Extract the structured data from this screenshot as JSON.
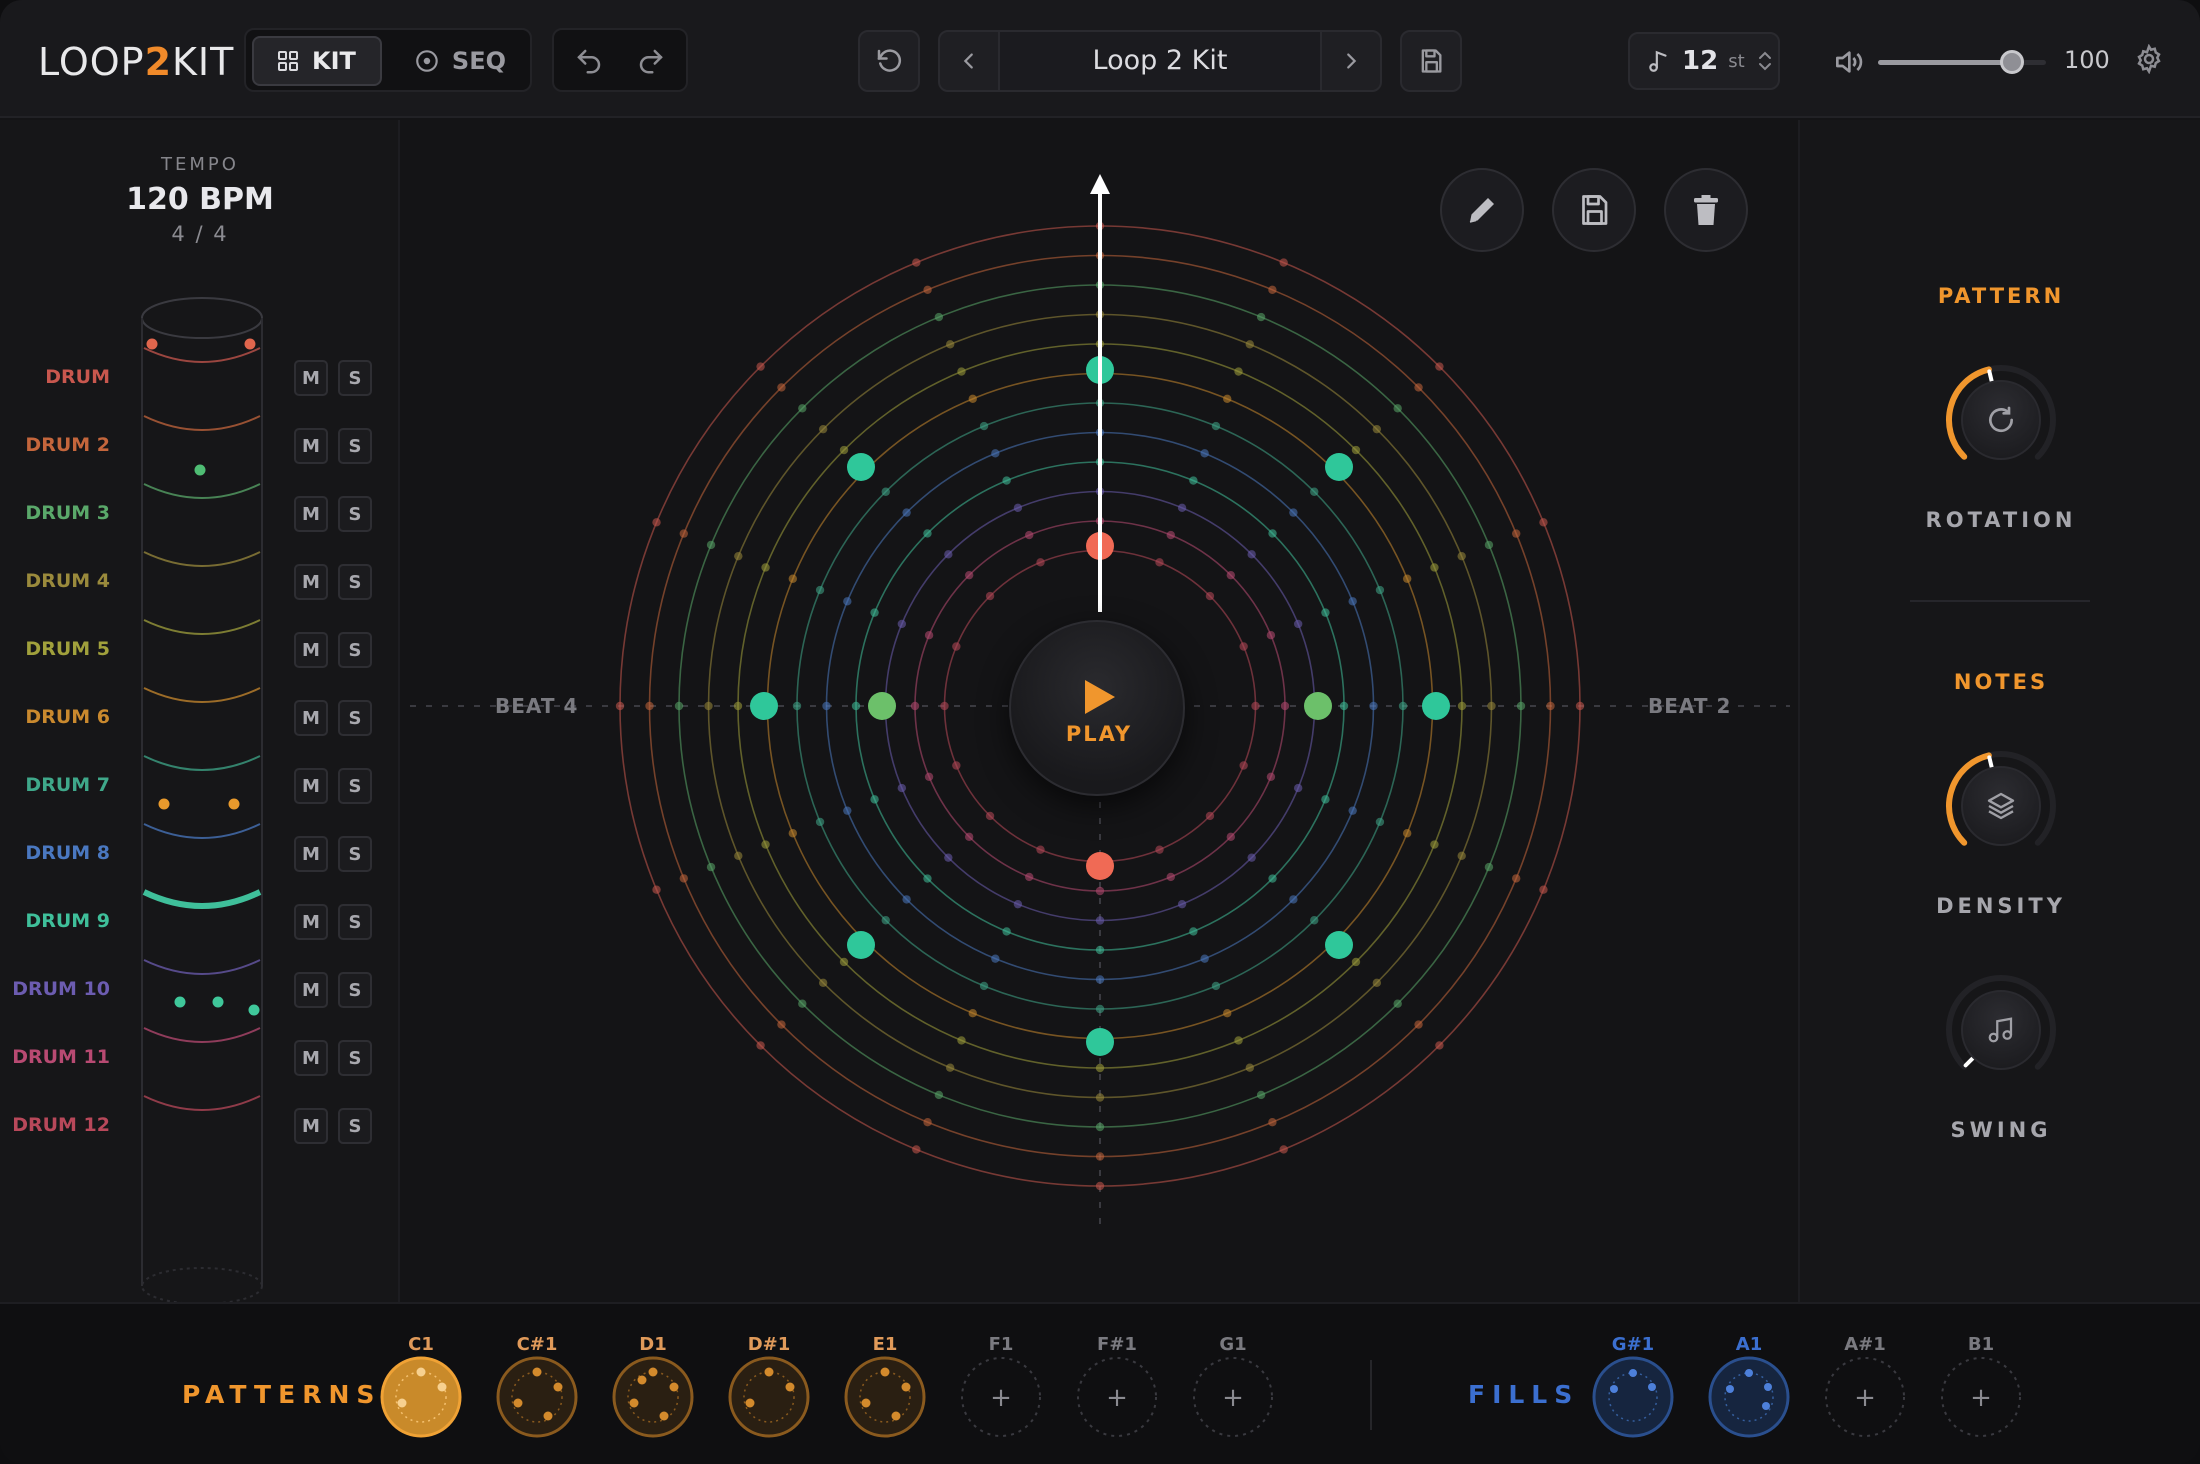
{
  "header": {
    "logo_a": "LOOP",
    "logo_b": "2",
    "logo_c": "KIT",
    "tab_kit": "KIT",
    "tab_seq": "SEQ",
    "preset_name": "Loop 2 Kit",
    "pitch_value": "12",
    "pitch_unit": "st",
    "volume_value": "100",
    "volume_level": 0.8
  },
  "left": {
    "tempo_label": "TEMPO",
    "tempo_value": "120 BPM",
    "time_signature": "4 / 4",
    "mute_label": "M",
    "solo_label": "S",
    "tracks": [
      {
        "name": "DRUM",
        "color": "#c8574e"
      },
      {
        "name": "DRUM 2",
        "color": "#c4663c"
      },
      {
        "name": "DRUM 3",
        "color": "#5aa86a"
      },
      {
        "name": "DRUM 4",
        "color": "#9a8a3c"
      },
      {
        "name": "DRUM 5",
        "color": "#a0a03c"
      },
      {
        "name": "DRUM 6",
        "color": "#c9892e"
      },
      {
        "name": "DRUM 7",
        "color": "#3fa88a"
      },
      {
        "name": "DRUM 8",
        "color": "#4a78c0"
      },
      {
        "name": "DRUM 9",
        "color": "#3fbf9a"
      },
      {
        "name": "DRUM 10",
        "color": "#6c5cb0"
      },
      {
        "name": "DRUM 11",
        "color": "#b84a72"
      },
      {
        "name": "DRUM 12",
        "color": "#b8485a"
      }
    ]
  },
  "center": {
    "beat_left": "BEAT 4",
    "beat_right": "BEAT 2",
    "play_label": "PLAY"
  },
  "right": {
    "pattern_title": "PATTERN",
    "rotation_label": "ROTATION",
    "rotation_level": 0.45,
    "notes_title": "NOTES",
    "density_label": "DENSITY",
    "density_level": 0.45,
    "swing_label": "SWING",
    "swing_level": 0.0
  },
  "bottom": {
    "patterns_label": "PATTERNS",
    "fills_label": "FILLS",
    "patterns": [
      {
        "note": "C1",
        "state": "selected"
      },
      {
        "note": "C#1",
        "state": "filled"
      },
      {
        "note": "D1",
        "state": "filled"
      },
      {
        "note": "D#1",
        "state": "filled"
      },
      {
        "note": "E1",
        "state": "filled"
      },
      {
        "note": "F1",
        "state": "empty"
      },
      {
        "note": "F#1",
        "state": "empty"
      },
      {
        "note": "G1",
        "state": "empty"
      }
    ],
    "fills": [
      {
        "note": "G#1",
        "state": "filled"
      },
      {
        "note": "A1",
        "state": "filled"
      },
      {
        "note": "A#1",
        "state": "empty"
      },
      {
        "note": "B1",
        "state": "empty"
      }
    ],
    "add_symbol": "+"
  },
  "colors": {
    "accent": "#f0962d",
    "fill_blue": "#3b6fd0",
    "teal": "#2fc79a",
    "coral": "#f06a55",
    "green": "#6cc06a"
  }
}
